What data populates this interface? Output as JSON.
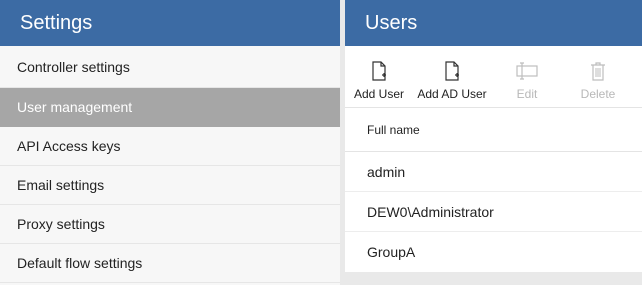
{
  "settings": {
    "title": "Settings",
    "items": [
      {
        "label": "Controller settings"
      },
      {
        "label": "User management"
      },
      {
        "label": "API Access keys"
      },
      {
        "label": "Email settings"
      },
      {
        "label": "Proxy settings"
      },
      {
        "label": "Default flow settings"
      }
    ],
    "active_index": 1
  },
  "users": {
    "title": "Users",
    "toolbar": {
      "add_user": "Add User",
      "add_ad_user": "Add AD User",
      "edit": "Edit",
      "delete": "Delete"
    },
    "column_header": "Full name",
    "rows": [
      {
        "full_name": "admin"
      },
      {
        "full_name": "DEW0\\Administrator"
      },
      {
        "full_name": "GroupA"
      }
    ]
  },
  "colors": {
    "header_bg": "#3c6ba4",
    "active_item_bg": "#a6a6a6",
    "disabled_text": "#b8b8b8"
  },
  "icons": [
    "add-user-icon",
    "add-ad-user-icon",
    "edit-icon",
    "delete-icon"
  ]
}
